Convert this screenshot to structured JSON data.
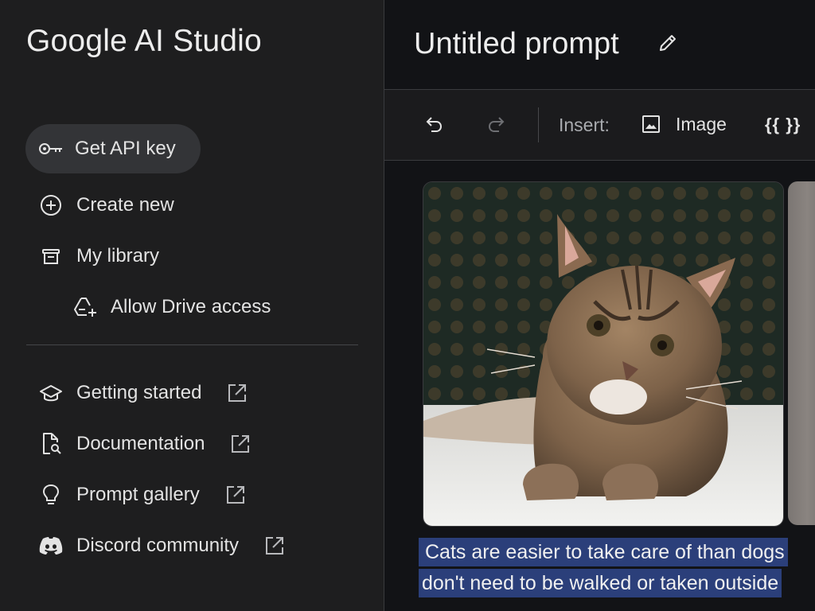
{
  "sidebar": {
    "app_title": "Google AI Studio",
    "get_api_key": "Get API key",
    "create_new": "Create new",
    "my_library": "My library",
    "allow_drive_access": "Allow Drive access",
    "links": [
      {
        "label": "Getting started"
      },
      {
        "label": "Documentation"
      },
      {
        "label": "Prompt gallery"
      },
      {
        "label": "Discord community"
      }
    ]
  },
  "header": {
    "title": "Untitled prompt"
  },
  "toolbar": {
    "insert_label": "Insert:",
    "image_label": "Image",
    "variable_label": "{{ }}"
  },
  "prompt": {
    "text_line_1": "Cats are easier to take care of than dogs",
    "text_line_2": "don't need to be walked or taken outside"
  },
  "colors": {
    "sidebar_bg": "#1e1e1f",
    "main_bg": "#121316",
    "selected_nav_bg": "#333437",
    "text_selection": "#2b3f7a"
  },
  "icons": [
    "key-icon",
    "add-circle-icon",
    "library-icon",
    "drive-add-icon",
    "school-icon",
    "document-search-icon",
    "lightbulb-icon",
    "discord-icon",
    "external-link-icon",
    "edit-icon",
    "undo-icon",
    "redo-icon",
    "image-icon"
  ]
}
